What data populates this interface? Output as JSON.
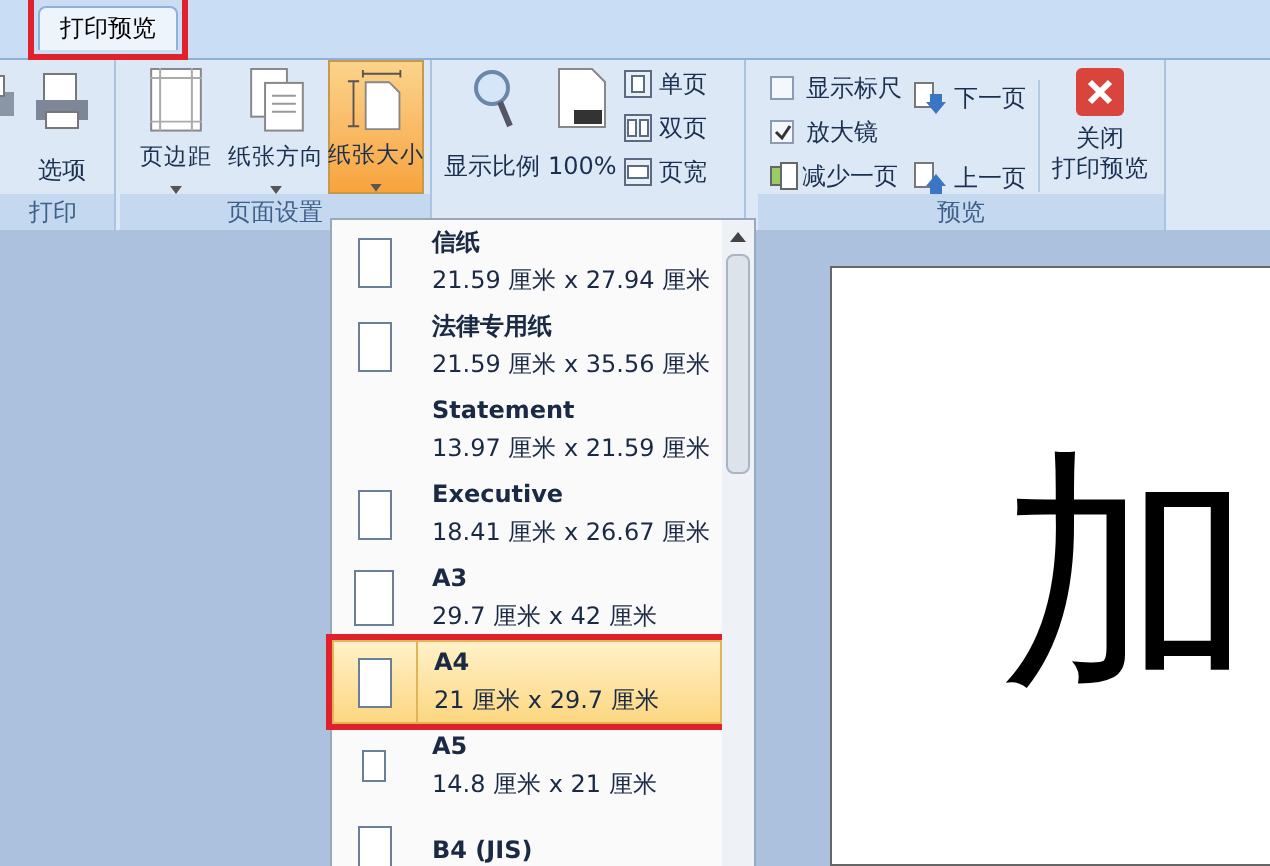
{
  "tabs": [
    {
      "label": "打印预览",
      "selected": true
    }
  ],
  "print_group": {
    "label": "打印",
    "buttons": [
      {
        "kind": "print"
      },
      {
        "label": "选项",
        "kind": "options"
      }
    ]
  },
  "page_setup_group": {
    "label": "页面设置",
    "buttons": [
      {
        "label": "页边距",
        "kind": "margins",
        "selected": false
      },
      {
        "label": "纸张方向",
        "kind": "orientation",
        "selected": false
      },
      {
        "label": "纸张大小",
        "kind": "size",
        "selected": true
      }
    ]
  },
  "zoom_group": {
    "zoom": "显示比例",
    "percent": "100%",
    "views": [
      {
        "label": "单页",
        "kind": "one"
      },
      {
        "label": "双页",
        "kind": "two"
      },
      {
        "label": "页宽",
        "kind": "width"
      }
    ]
  },
  "preview_group": {
    "label": "预览",
    "checks": [
      {
        "label": "显示标尺",
        "checked": false
      },
      {
        "label": "放大镜",
        "checked": true
      }
    ],
    "shrink": "减少一页",
    "next": "下一页",
    "prev": "上一页",
    "close_lines": [
      "关闭",
      "打印预览"
    ]
  },
  "paper_sizes": [
    {
      "name": "信纸",
      "size": "21.59 厘米 x 27.94 厘米",
      "selected": false,
      "kind": "tall"
    },
    {
      "name": "法律专用纸",
      "size": "21.59 厘米 x 35.56 厘米",
      "selected": false,
      "kind": "tall"
    },
    {
      "name": "Statement",
      "size": "13.97 厘米 x 21.59 厘米",
      "selected": false,
      "kind": "plain"
    },
    {
      "name": "Executive",
      "size": "18.41 厘米 x 26.67 厘米",
      "selected": false,
      "kind": "tall"
    },
    {
      "name": "A3",
      "size": "29.7 厘米 x 42 厘米",
      "selected": false,
      "kind": "large"
    },
    {
      "name": "A4",
      "size": "21 厘米 x 29.7 厘米",
      "selected": true,
      "kind": "tall"
    },
    {
      "name": "A5",
      "size": "14.8 厘米 x 21 厘米",
      "selected": false,
      "kind": "small"
    },
    {
      "name": "B4 (JIS)",
      "selected": false,
      "kind": "tall"
    }
  ],
  "page_text": "加"
}
